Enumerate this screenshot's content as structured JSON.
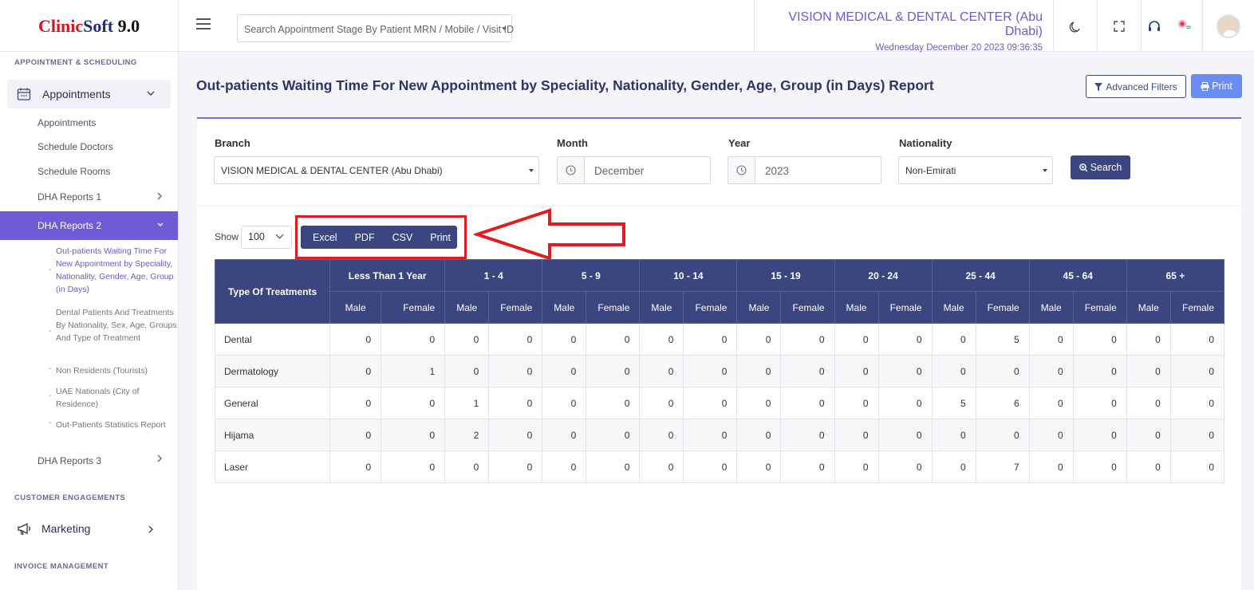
{
  "app": {
    "logo": {
      "part1": "Clinic",
      "part2": "Soft",
      "part3": " 9.0"
    },
    "search_placeholder": "Search Appointment Stage By Patient MRN / Mobile / Visit ID",
    "clinic_name": "VISION MEDICAL & DENTAL CENTER (Abu Dhabi)",
    "datetime": "Wednesday December 20 2023 09:36:35"
  },
  "sidebar": {
    "section1": "APPOINTMENT & SCHEDULING",
    "appointments": "Appointments",
    "sub_items": [
      "Appointments",
      "Schedule Doctors",
      "Schedule Rooms"
    ],
    "dha1": "DHA Reports 1",
    "dha2": "DHA Reports 2",
    "dha2_items": [
      "Out-patients Waiting Time For New Appointment by Speciality, Nationality, Gender, Age, Group (in Days)",
      "Dental Patients And Treatments By Nationality, Sex, Age, Groups And Type of Treatment",
      "Non Residents (Tourists)",
      "UAE Nationals (City of Residence)",
      "Out-Patients Statistics Report"
    ],
    "dha3": "DHA Reports 3",
    "section2": "CUSTOMER ENGAGEMENTS",
    "marketing": "Marketing",
    "section3": "INVOICE MANAGEMENT"
  },
  "page": {
    "title": "Out-patients Waiting Time For New Appointment by Speciality, Nationality, Gender, Age, Group (in Days) Report",
    "advanced_filters": "Advanced Filters",
    "print": "Print"
  },
  "filters": {
    "branch_label": "Branch",
    "branch_value": "VISION MEDICAL & DENTAL CENTER (Abu Dhabi)",
    "month_label": "Month",
    "month_value": "December",
    "year_label": "Year",
    "year_value": "2023",
    "nationality_label": "Nationality",
    "nationality_value": "Non-Emirati",
    "search_button": "Search"
  },
  "table_controls": {
    "show_label": "Show",
    "page_size": "100",
    "exports": [
      "Excel",
      "PDF",
      "CSV",
      "Print"
    ]
  },
  "table": {
    "first_header": "Type Of Treatments",
    "age_groups": [
      "Less Than 1 Year",
      "1 - 4",
      "5 - 9",
      "10 - 14",
      "15 - 19",
      "20 - 24",
      "25 - 44",
      "45 - 64",
      "65 +"
    ],
    "gender_headers": [
      "Male",
      "Female"
    ],
    "rows": [
      {
        "name": "Dental",
        "values": [
          "0",
          "0",
          "0",
          "0",
          "0",
          "0",
          "0",
          "0",
          "0",
          "0",
          "0",
          "0",
          "0",
          "5",
          "0",
          "0",
          "0",
          "0"
        ]
      },
      {
        "name": "Dermatology",
        "values": [
          "0",
          "1",
          "0",
          "0",
          "0",
          "0",
          "0",
          "0",
          "0",
          "0",
          "0",
          "0",
          "0",
          "0",
          "0",
          "0",
          "0",
          "0"
        ]
      },
      {
        "name": "General",
        "values": [
          "0",
          "0",
          "1",
          "0",
          "0",
          "0",
          "0",
          "0",
          "0",
          "0",
          "0",
          "0",
          "5",
          "6",
          "0",
          "0",
          "0",
          "0"
        ]
      },
      {
        "name": "Hijama",
        "values": [
          "0",
          "0",
          "2",
          "0",
          "0",
          "0",
          "0",
          "0",
          "0",
          "0",
          "0",
          "0",
          "0",
          "0",
          "0",
          "0",
          "0",
          "0"
        ]
      },
      {
        "name": "Laser",
        "values": [
          "0",
          "0",
          "0",
          "0",
          "0",
          "0",
          "0",
          "0",
          "0",
          "0",
          "0",
          "0",
          "0",
          "7",
          "0",
          "0",
          "0",
          "0"
        ]
      }
    ]
  },
  "colors": {
    "accent": "#6a5bd1",
    "header_bg": "#3b4580",
    "highlight": "#e01e22"
  }
}
